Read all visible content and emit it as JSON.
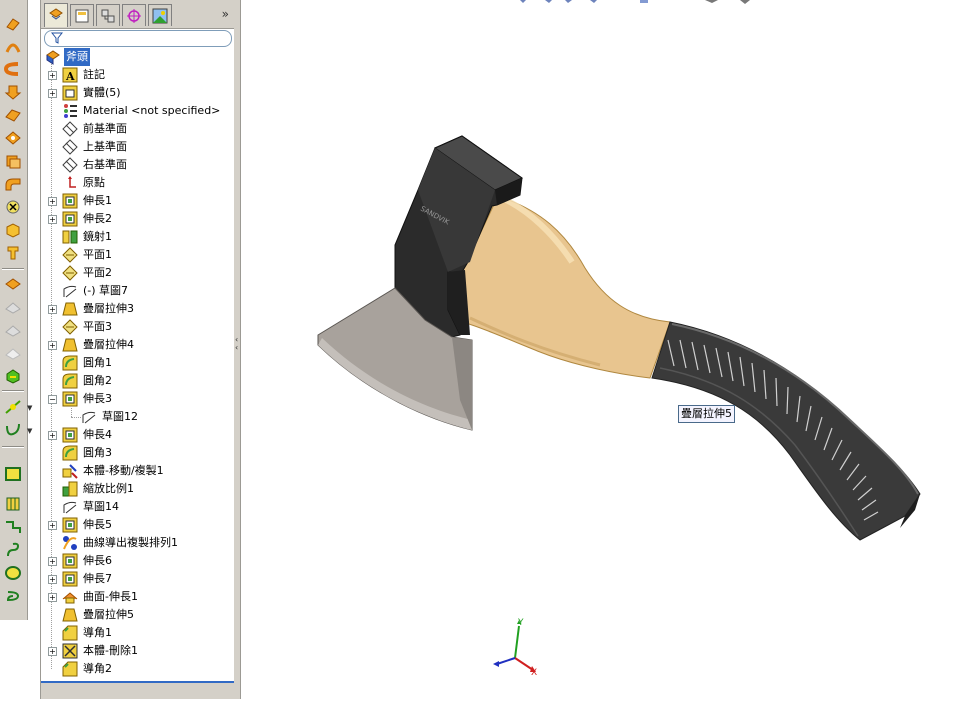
{
  "feature_tree": {
    "root": "斧頭",
    "items": [
      {
        "label": "註記",
        "icon": "annotations-icon",
        "expand": "+"
      },
      {
        "label": "實體(5)",
        "icon": "solid-bodies-icon",
        "expand": "+"
      },
      {
        "label": "Material <not specified>",
        "icon": "material-icon",
        "expand": ""
      },
      {
        "label": "前基準面",
        "icon": "plane-icon",
        "expand": ""
      },
      {
        "label": "上基準面",
        "icon": "plane-icon",
        "expand": ""
      },
      {
        "label": "右基準面",
        "icon": "plane-icon",
        "expand": ""
      },
      {
        "label": "原點",
        "icon": "origin-icon",
        "expand": ""
      },
      {
        "label": "伸長1",
        "icon": "extrude-icon",
        "expand": "+"
      },
      {
        "label": "伸長2",
        "icon": "extrude-icon",
        "expand": "+"
      },
      {
        "label": "鏡射1",
        "icon": "mirror-icon",
        "expand": ""
      },
      {
        "label": "平面1",
        "icon": "plane-feature-icon",
        "expand": ""
      },
      {
        "label": "平面2",
        "icon": "plane-feature-icon",
        "expand": ""
      },
      {
        "label": "(-) 草圖7",
        "icon": "sketch-icon",
        "expand": ""
      },
      {
        "label": "疊層拉伸3",
        "icon": "loft-icon",
        "expand": "+"
      },
      {
        "label": "平面3",
        "icon": "plane-feature-icon",
        "expand": ""
      },
      {
        "label": "疊層拉伸4",
        "icon": "loft-icon",
        "expand": "+"
      },
      {
        "label": "圓角1",
        "icon": "fillet-icon",
        "expand": ""
      },
      {
        "label": "圓角2",
        "icon": "fillet-icon",
        "expand": ""
      },
      {
        "label": "伸長3",
        "icon": "extrude-icon",
        "expand": "−"
      },
      {
        "label": "草圖12",
        "icon": "sketch-icon",
        "expand": "",
        "child": true
      },
      {
        "label": "伸長4",
        "icon": "extrude-icon",
        "expand": "+"
      },
      {
        "label": "圓角3",
        "icon": "fillet-icon",
        "expand": ""
      },
      {
        "label": "本體-移動/複製1",
        "icon": "move-body-icon",
        "expand": ""
      },
      {
        "label": "縮放比例1",
        "icon": "scale-icon",
        "expand": ""
      },
      {
        "label": "草圖14",
        "icon": "sketch-icon",
        "expand": ""
      },
      {
        "label": "伸長5",
        "icon": "extrude-icon",
        "expand": "+"
      },
      {
        "label": "曲線導出複製排列1",
        "icon": "curve-pattern-icon",
        "expand": ""
      },
      {
        "label": "伸長6",
        "icon": "extrude-icon",
        "expand": "+"
      },
      {
        "label": "伸長7",
        "icon": "extrude-icon",
        "expand": "+"
      },
      {
        "label": "曲面-伸長1",
        "icon": "surface-extrude-icon",
        "expand": "+"
      },
      {
        "label": "疊層拉伸5",
        "icon": "loft-icon",
        "expand": ""
      },
      {
        "label": "導角1",
        "icon": "chamfer-icon",
        "expand": ""
      },
      {
        "label": "本體-刪除1",
        "icon": "delete-body-icon",
        "expand": "+"
      },
      {
        "label": "導角2",
        "icon": "chamfer-icon",
        "expand": ""
      }
    ]
  },
  "viewport": {
    "tooltip": "疊層拉伸5",
    "triad": {
      "x": "X",
      "y": "Y"
    },
    "engraving": "SANDVIK"
  },
  "colors": {
    "selection": "#316ac5",
    "panel_bg": "#d4d0c8",
    "head_dark": "#2b2b2b",
    "blade": "#a8a29c",
    "handle_wood": "#e8c58f",
    "grip": "#3a3a3a"
  }
}
